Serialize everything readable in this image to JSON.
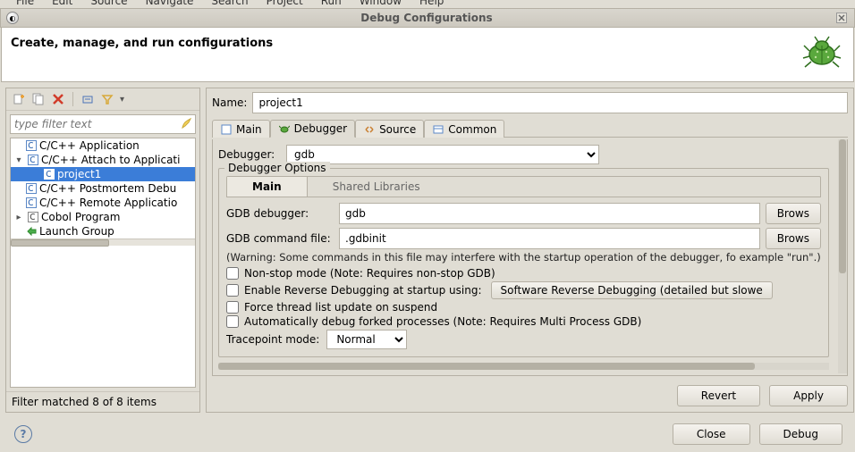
{
  "menubar": [
    "File",
    "Edit",
    "Source",
    "Navigate",
    "Search",
    "Project",
    "Run",
    "Window",
    "Help"
  ],
  "window_title": "Debug Configurations",
  "header_title": "Create, manage, and run configurations",
  "filter_placeholder": "type filter text",
  "tree": {
    "items": [
      {
        "label": "C/C++ Application"
      },
      {
        "label": "C/C++ Attach to Applicati",
        "expanded": true,
        "children": [
          {
            "label": "project1",
            "selected": true
          }
        ]
      },
      {
        "label": "C/C++ Postmortem Debu"
      },
      {
        "label": "C/C++ Remote Applicatio"
      },
      {
        "label": "Cobol Program"
      },
      {
        "label": "Launch Group"
      }
    ]
  },
  "filter_status": "Filter matched 8 of 8 items",
  "name_label": "Name:",
  "name_value": "project1",
  "tabs": {
    "main": "Main",
    "debugger": "Debugger",
    "source": "Source",
    "common": "Common"
  },
  "debugger": {
    "debugger_label": "Debugger:",
    "debugger_value": "gdb",
    "options_legend": "Debugger Options",
    "subtabs": {
      "main": "Main",
      "shared": "Shared Libraries"
    },
    "gdb_debugger_label": "GDB debugger:",
    "gdb_debugger_value": "gdb",
    "gdb_cmdfile_label": "GDB command file:",
    "gdb_cmdfile_value": ".gdbinit",
    "browse_label": "Brows",
    "warning": "(Warning: Some commands in this file may interfere with the startup operation of the debugger, fo example \"run\".)",
    "nonstop": "Non-stop mode (Note: Requires non-stop GDB)",
    "reverse": "Enable Reverse Debugging at startup using:",
    "reverse_btn": "Software Reverse Debugging (detailed but slowe",
    "force_thread": "Force thread list update on suspend",
    "autofork": "Automatically debug forked processes (Note: Requires Multi Process GDB)",
    "tracepoint_label": "Tracepoint mode:",
    "tracepoint_value": "Normal"
  },
  "buttons": {
    "revert": "Revert",
    "apply": "Apply",
    "close": "Close",
    "debug": "Debug"
  }
}
